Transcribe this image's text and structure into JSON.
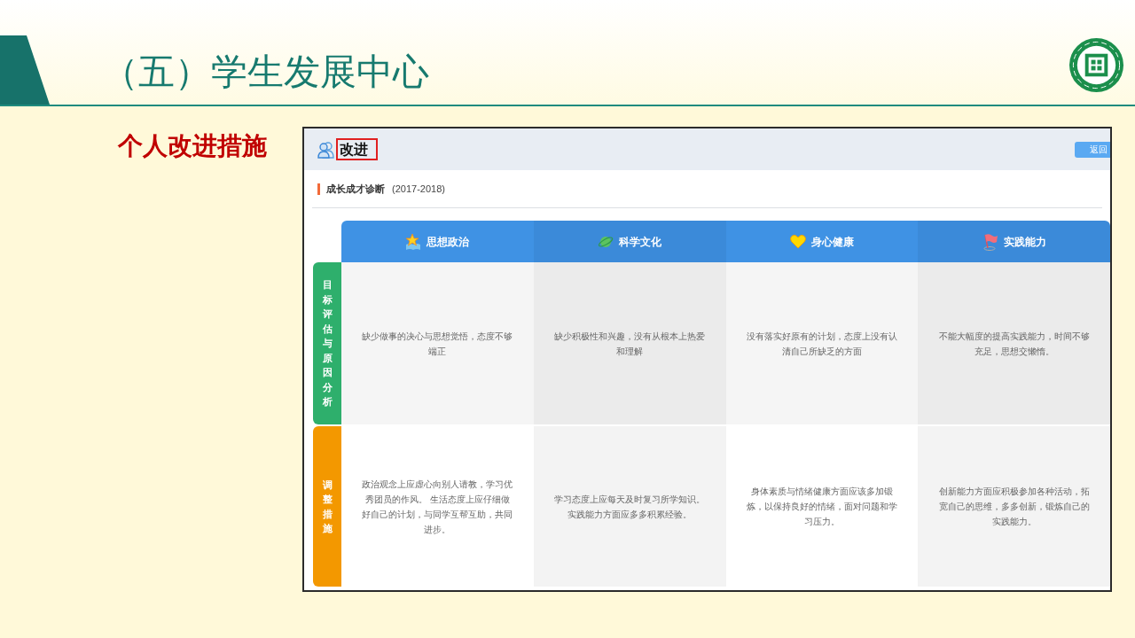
{
  "slide": {
    "title": "（五）学生发展中心",
    "subtitle": "个人改进措施"
  },
  "screenshot": {
    "header": {
      "title": "改进",
      "button": "返回"
    },
    "section": {
      "title": "成长成才诊断",
      "period": "(2017-2018)"
    },
    "table": {
      "columns": [
        {
          "label": "思想政治",
          "kind": "star"
        },
        {
          "label": "科学文化",
          "kind": "planet"
        },
        {
          "label": "身心健康",
          "kind": "heart"
        },
        {
          "label": "实践能力",
          "kind": "flag"
        }
      ],
      "rows": [
        {
          "label": "目标评估与原因分析",
          "color": "#2eaf6c",
          "cells": [
            "缺少做事的决心与思想觉悟，态度不够端正",
            "缺少积极性和兴趣，没有从根本上热爱和理解",
            "没有落实好原有的计划，态度上没有认清自己所缺乏的方面",
            "不能大幅度的提高实践能力，时间不够充足，思想交懒惰。"
          ]
        },
        {
          "label": "调整措施",
          "color": "#f39800",
          "cells": [
            "政治观念上应虚心向别人请教，学习优秀团员的作风。 生活态度上应仔细做好自己的计划，与同学互帮互助，共同进步。",
            "学习态度上应每天及时复习所学知识。实践能力方面应多多积累经验。",
            "身体素质与情绪健康方面应该多加锻炼，以保持良好的情绪，面对问题和学习压力。",
            "创新能力方面应积极参加各种活动，拓宽自己的思维，多多创新，锻炼自己的实践能力。"
          ]
        }
      ]
    }
  }
}
